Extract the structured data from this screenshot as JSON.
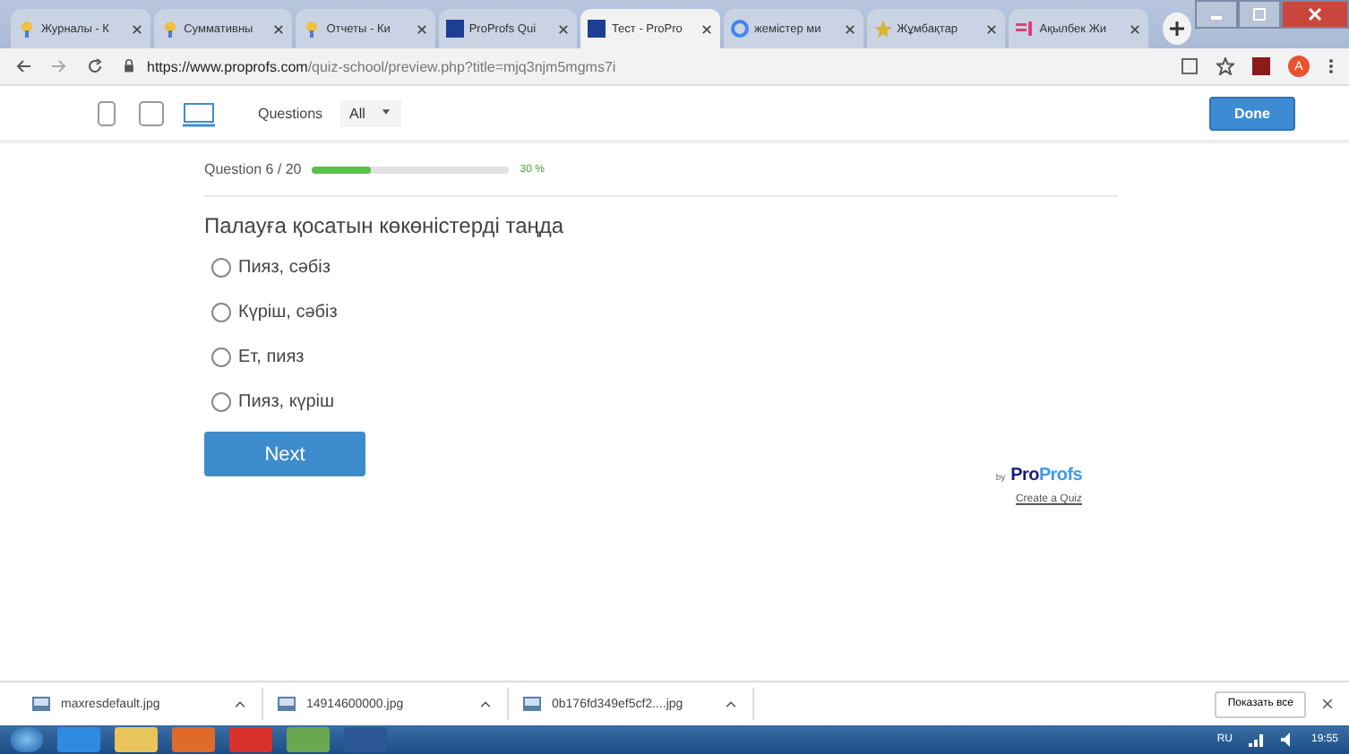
{
  "browser": {
    "tabs": [
      {
        "title": "Журналы - К",
        "selected": false,
        "kind": "badge"
      },
      {
        "title": "Суммативны",
        "selected": false,
        "kind": "badge"
      },
      {
        "title": "Отчеты - Ки",
        "selected": false,
        "kind": "badge"
      },
      {
        "title": "ProProfs Qui",
        "selected": false,
        "kind": "square"
      },
      {
        "title": "Тест - ProPro",
        "selected": true,
        "kind": "square"
      },
      {
        "title": "жемістер ми",
        "selected": false,
        "kind": "ring"
      },
      {
        "title": "Жұмбақтар",
        "selected": false,
        "kind": "star"
      },
      {
        "title": "Ақылбек Жи",
        "selected": false,
        "kind": "bars"
      }
    ],
    "url_host": "https://www.proprofs.com",
    "url_path": "/quiz-school/preview.php?title=mjq3njm5mgms7i",
    "avatar": "A"
  },
  "toolbar": {
    "questions_label": "Questions",
    "questions_value": "All",
    "devices": [
      {
        "kind": "phone",
        "selected": false
      },
      {
        "kind": "tablet",
        "selected": false
      },
      {
        "kind": "laptop",
        "selected": true
      }
    ],
    "done": "Done"
  },
  "quiz": {
    "progress_label": "Question 6 / 20",
    "level": 0.3,
    "percent": "30 %",
    "question": "Палауға қосатын көкөністерді таңда",
    "options": [
      {
        "label": "Пияз, сәбіз",
        "selected": false
      },
      {
        "label": "Күріш, сәбіз",
        "selected": false
      },
      {
        "label": "Ет, пияз",
        "selected": false
      },
      {
        "label": "Пияз, күріш",
        "selected": false
      }
    ],
    "next": "Next",
    "by": "by",
    "logo_parts": [
      "Pro",
      "Profs"
    ],
    "create": "Create a Quiz"
  },
  "downloads": {
    "items": [
      "maxresdefault.jpg",
      "14914600000.jpg",
      "0b176fd349ef5cf2....jpg"
    ],
    "show_all": "Показать все"
  },
  "taskbar": {
    "lang": "RU",
    "time": "19:55"
  }
}
